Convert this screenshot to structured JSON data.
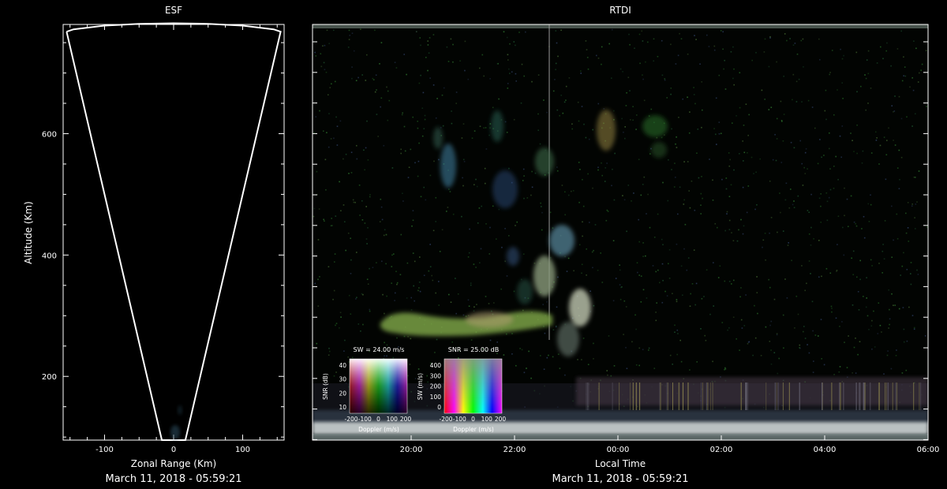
{
  "colors": {
    "background": "#000000",
    "foreground": "#ffffff",
    "esf_frame": "#ffffff"
  },
  "chart_data": [
    {
      "type": "scatter",
      "panel": "ESF",
      "title": "ESF",
      "xlabel": "Zonal Range (Km)",
      "ylabel": "Altitude (Km)",
      "xlim": [
        -160,
        160
      ],
      "ylim": [
        95,
        780
      ],
      "x_ticks": [
        -100,
        0,
        100
      ],
      "y_ticks": [
        200,
        400,
        600
      ],
      "timestamp": "March 11, 2018 - 05:59:21",
      "outline": [
        [
          -155,
          768
        ],
        [
          -145,
          772
        ],
        [
          -100,
          778
        ],
        [
          -50,
          781
        ],
        [
          0,
          782
        ],
        [
          50,
          781
        ],
        [
          100,
          778
        ],
        [
          145,
          772
        ],
        [
          155,
          768
        ],
        [
          17,
          95
        ],
        [
          -17,
          95
        ],
        [
          -155,
          768
        ]
      ],
      "notes": "fan-shaped radar coverage region drawn as a white outline; interior mostly black"
    },
    {
      "type": "heatmap",
      "panel": "RTDI",
      "title": "RTDI",
      "xlabel": "Local Time",
      "x_ticks": [
        "20:00",
        "22:00",
        "00:00",
        "02:00",
        "04:00",
        "06:00"
      ],
      "timestamp": "March 11, 2018 - 05:59:21",
      "notes": "range-time-Doppler-intensity image; mostly dark with a plume of echoes near 22:30-23:30 and a bright band at the bottom edge",
      "legends": [
        {
          "title": "SW = 24.00 m/s",
          "xlabel": "Doppler (m/s)",
          "ylabel": "SNR (dB)",
          "x_ticks": [
            "-200",
            "-100",
            "0",
            "100",
            "200"
          ],
          "y_ticks": [
            "10",
            "20",
            "30",
            "40"
          ]
        },
        {
          "title": "SNR = 25.00 dB",
          "xlabel": "Doppler (m/s)",
          "ylabel": "SW (m/s)",
          "x_ticks": [
            "-200",
            "-100",
            "0",
            "100",
            "200"
          ],
          "y_ticks": [
            "0",
            "100",
            "200",
            "300",
            "400"
          ]
        }
      ]
    }
  ]
}
